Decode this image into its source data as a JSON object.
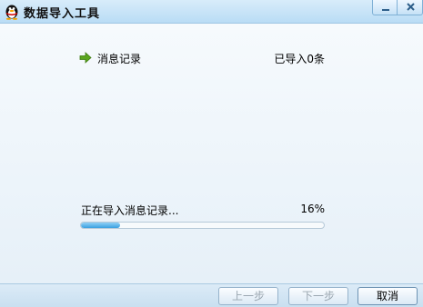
{
  "window": {
    "title": "数据导入工具"
  },
  "task": {
    "label": "消息记录",
    "status": "已导入0条"
  },
  "progress": {
    "text": "正在导入消息记录...",
    "percent_label": "16%",
    "fraction": 0.16
  },
  "buttons": {
    "prev": "上一步",
    "next": "下一步",
    "cancel": "取消"
  },
  "colors": {
    "progress_fill": "#3aa0e0",
    "arrow": "#5aa51e"
  },
  "icons": {
    "app": "qq-penguin-icon",
    "row": "green-arrow-right-icon"
  }
}
